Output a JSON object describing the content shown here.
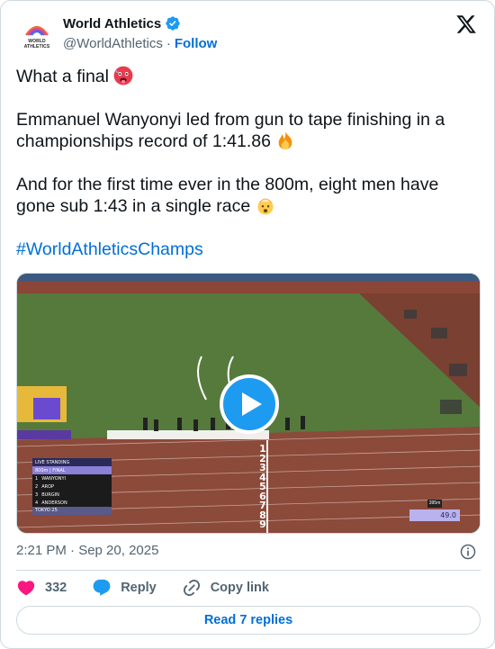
{
  "author": {
    "display_name": "World Athletics",
    "handle": "@WorldAthletics",
    "separator": "·",
    "follow_label": "Follow",
    "verified": true,
    "avatar_text_line1": "WORLD",
    "avatar_text_line2": "ATHLETICS"
  },
  "tweet": {
    "line1": "What a final",
    "line1_emoji": "hot-face-emoji",
    "para2": "Emmanuel Wanyonyi led from gun to tape finishing in a championships record of 1:41.86",
    "para2_emoji": "fire-emoji",
    "para3": "And for the first time ever in the 800m, eight men have gone sub 1:43 in a single race",
    "para3_emoji": "exploding-head-emoji",
    "hashtag": "#WorldAthleticsChamps"
  },
  "media": {
    "type": "video",
    "overlay": {
      "title": "LIVE STANDING",
      "event": "800m | FINAL",
      "rows": [
        {
          "pos": "1",
          "name": "WANYONYI"
        },
        {
          "pos": "2",
          "name": "AROP"
        },
        {
          "pos": "3",
          "name": "BURGIN"
        },
        {
          "pos": "4",
          "name": "ANDERSON"
        }
      ],
      "footer": "TOKYO 25",
      "distance": "395m",
      "time": "49.0"
    },
    "finish_numbers": [
      "1",
      "2",
      "3",
      "4",
      "5",
      "6",
      "7",
      "8",
      "9"
    ]
  },
  "meta": {
    "timestamp": "2:21 PM · Sep 20, 2025"
  },
  "actions": {
    "like_count": "332",
    "reply_label": "Reply",
    "copy_link_label": "Copy link"
  },
  "read_replies_label": "Read 7 replies",
  "colors": {
    "accent": "#006fd6",
    "verified": "#1d9bf0",
    "like": "#f91880",
    "text": "#0f1419",
    "muted": "#536471",
    "border": "#cfd9de"
  }
}
